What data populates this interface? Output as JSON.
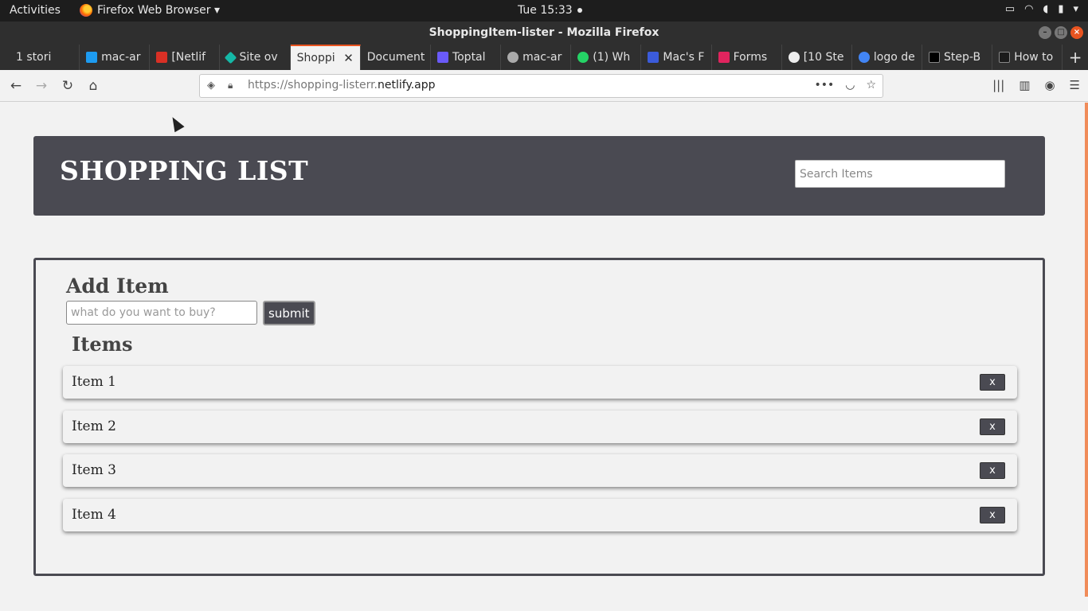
{
  "system_bar": {
    "activities": "Activities",
    "app_name": "Firefox Web Browser ▾",
    "clock": "Tue 15:33"
  },
  "window": {
    "title": "ShoppingItem-lister - Mozilla Firefox"
  },
  "tabs": [
    {
      "label": "1 stori",
      "favicon_color": "#7a7a7a"
    },
    {
      "label": "mac-ar",
      "favicon_color": "#1d9bf0"
    },
    {
      "label": "[Netlif",
      "favicon_color": "#d93025"
    },
    {
      "label": "Site ov",
      "favicon_color": "#15b8a6"
    },
    {
      "label": "Shoppi",
      "favicon_color": "#bbbbbb",
      "active": true
    },
    {
      "label": "Document",
      "favicon_color": "#2f2f2f"
    },
    {
      "label": "Toptal",
      "favicon_color": "#6a5af9"
    },
    {
      "label": "mac-ar",
      "favicon_color": "#aaaaaa"
    },
    {
      "label": "(1) Wh",
      "favicon_color": "#25d366"
    },
    {
      "label": "Mac's F",
      "favicon_color": "#3b5bdb"
    },
    {
      "label": "Forms",
      "favicon_color": "#e0245e"
    },
    {
      "label": "[10 Ste",
      "favicon_color": "#eeeeee"
    },
    {
      "label": "logo de",
      "favicon_color": "#4285f4"
    },
    {
      "label": "Step-B",
      "favicon_color": "#000000"
    },
    {
      "label": "How to",
      "favicon_color": "#1b1b1b"
    }
  ],
  "navbar": {
    "url_prefix": "https://shopping-listerr.",
    "url_domain": "netlify.app"
  },
  "app": {
    "title": "SHOPPING LIST",
    "search_placeholder": "Search Items",
    "add_title": "Add Item",
    "add_placeholder": "what do you want to buy?",
    "submit_label": "submit",
    "items_title": "Items",
    "delete_label": "x",
    "items": [
      "Item 1",
      "Item 2",
      "Item 3",
      "Item 4"
    ]
  },
  "colors": {
    "header_bg": "#4a4a52",
    "accent": "#e95420"
  }
}
